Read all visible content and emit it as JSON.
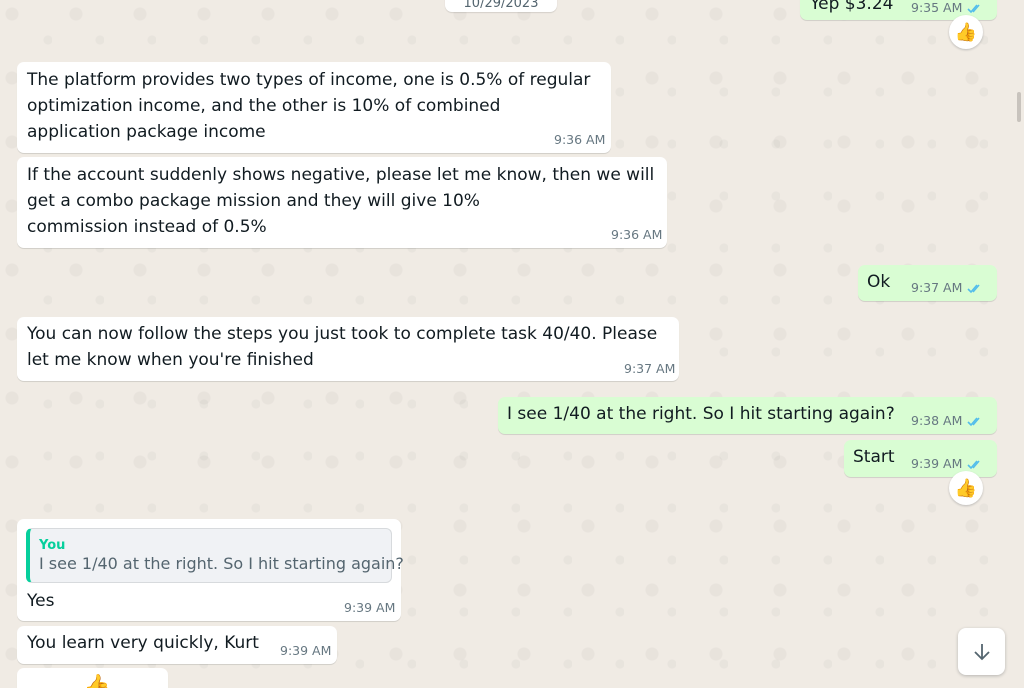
{
  "date_divider": "10/29/2023",
  "messages": [
    {
      "direction": "outgoing",
      "text": "Yep $3.24",
      "time": "9:35 AM",
      "reaction": "👍"
    },
    {
      "direction": "incoming",
      "lines": [
        "The platform provides two types of income, one is 0.5% of regular",
        "optimization income, and the other is 10% of combined",
        "application package income"
      ],
      "time": "9:36 AM"
    },
    {
      "direction": "incoming",
      "lines": [
        "If the account suddenly shows negative, please let me know, then we will",
        "get a combo package mission and they will give 10%",
        "commission instead of 0.5%"
      ],
      "time": "9:36 AM"
    },
    {
      "direction": "outgoing",
      "text": "Ok",
      "time": "9:37 AM"
    },
    {
      "direction": "incoming",
      "lines": [
        "You can now follow the steps you just took to complete task 40/40. Please",
        "let me know when you're finished"
      ],
      "time": "9:37 AM"
    },
    {
      "direction": "outgoing",
      "text": "I see 1/40 at the right. So I hit starting again?",
      "time": "9:38 AM"
    },
    {
      "direction": "outgoing",
      "text": "Start",
      "time": "9:39 AM",
      "reaction": "👍"
    },
    {
      "direction": "incoming",
      "quote": {
        "author": "You",
        "text": "I see 1/40 at the right. So I hit starting again?"
      },
      "text": "Yes",
      "time": "9:39 AM"
    },
    {
      "direction": "incoming",
      "text": "You learn very quickly, Kurt",
      "time": "9:39 AM"
    },
    {
      "direction": "incoming",
      "text": "👍"
    }
  ],
  "icons": {
    "read_receipt": "double-check-icon",
    "scroll_down": "chevron-down-icon"
  },
  "colors": {
    "chat_background": "#f0ebe4",
    "incoming_bubble": "#ffffff",
    "outgoing_bubble": "#d9fdd3",
    "read_ticks": "#53bdeb",
    "quote_accent": "#06cf9c",
    "timestamp": "#667781"
  }
}
